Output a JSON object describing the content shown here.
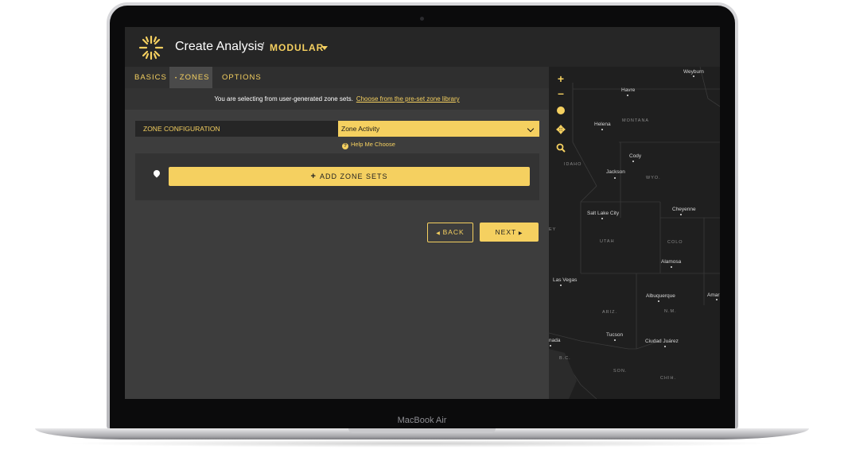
{
  "device": {
    "label": "MacBook Air"
  },
  "header": {
    "title": "Create Analysis",
    "separator": "/",
    "module": "MODULAR"
  },
  "tabs": [
    {
      "label": "BASICS"
    },
    {
      "label": "ZONES",
      "active": true
    },
    {
      "label": "OPTIONS"
    }
  ],
  "notice": {
    "text": "You are selecting from user-generated zone sets.",
    "link": "Choose from the pre-set zone library"
  },
  "config": {
    "label": "ZONE CONFIGURATION",
    "value": "Zone Activity",
    "help": "Help Me Choose"
  },
  "zones": {
    "add_label": "ADD ZONE SETS"
  },
  "nav": {
    "back": "BACK",
    "next": "NEXT"
  },
  "map": {
    "cities": [
      "Weyburn",
      "Havre",
      "Helena",
      "Cody",
      "Jackson",
      "Salt Lake City",
      "Cheyenne",
      "Alamosa",
      "Las Vegas",
      "Albuquerque",
      "Amar",
      "Tucson",
      "Ciudad Juárez",
      "nada"
    ],
    "states": [
      "MONTANA",
      "IDAHO",
      "WYO.",
      "UTAH",
      "COLO",
      "ARIZ.",
      "N.M.",
      "SON.",
      "CHIH.",
      "B.C.",
      "EY"
    ]
  },
  "colors": {
    "accent": "#f5d060",
    "panel": "#3d3d3d",
    "header": "#262626",
    "map": "#1f1f1f"
  },
  "icons": [
    "logo-sun-icon",
    "caret-down-icon",
    "chevron-down-icon",
    "help-circle-icon",
    "map-pin-icon",
    "plus-icon",
    "caret-left-icon",
    "caret-right-icon",
    "zoom-in-icon",
    "zoom-out-icon",
    "compass-icon",
    "pan-icon",
    "search-icon"
  ]
}
